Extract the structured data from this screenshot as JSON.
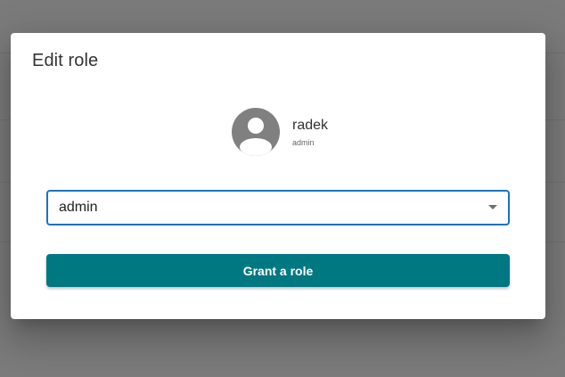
{
  "dialog": {
    "title": "Edit role"
  },
  "user": {
    "name": "radek",
    "role": "admin",
    "avatar_icon": "account-circle-icon",
    "avatar_color": "#808080"
  },
  "role_select": {
    "value": "admin",
    "icon": "dropdown-arrow-icon",
    "focus_color": "#1a73c2"
  },
  "actions": {
    "grant_label": "Grant a role",
    "grant_color": "#007882"
  }
}
